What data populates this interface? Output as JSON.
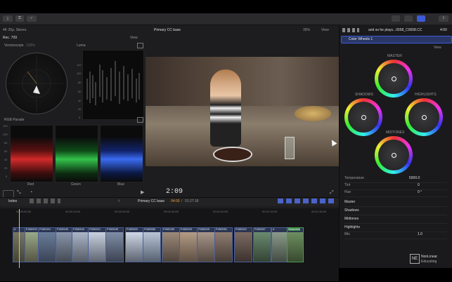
{
  "toolbar": {
    "left_icons": [
      "import-icon",
      "key-icon",
      "check-icon"
    ]
  },
  "browser": {
    "format": "4K 25p, Stereo",
    "color": "Rec. 709",
    "view": "View"
  },
  "scopes": {
    "vectorscope": "Vectorscope",
    "vectorscope_pct": "133%",
    "luma": "Luma",
    "rgb": "RGB Parade",
    "luma_ticks": [
      "120",
      "100",
      "80",
      "60",
      "40",
      "20",
      "0",
      "-20"
    ],
    "rgb_ticks": [
      "120",
      "100",
      "80",
      "60",
      "40",
      "20",
      "0",
      "-20"
    ],
    "rgb_labels": [
      "Red",
      "Green",
      "Blue"
    ]
  },
  "viewer": {
    "title": "Primary CC base",
    "zoom": "35%",
    "view": "View",
    "timecode": "2:09"
  },
  "inspector": {
    "clip_name": "and so he plays...0558_C0008.CC",
    "duration": "4:00",
    "effect": "Color Wheels 1",
    "view": "View",
    "wheels": [
      "MASTER",
      "SHADOWS",
      "HIGHLIGHTS",
      "MIDTONES"
    ],
    "params": [
      {
        "label": "Temperature",
        "value": "5000.0"
      },
      {
        "label": "Tint",
        "value": "0"
      },
      {
        "label": "Hue",
        "value": "0 °"
      }
    ],
    "sections": [
      "Master",
      "Shadows",
      "Midtones",
      "Highlights"
    ],
    "mix": {
      "label": "Mix",
      "value": "1.0"
    }
  },
  "timeline": {
    "index": "Index",
    "project": "Primary CC base",
    "position": "04:00",
    "duration": "01:27:18",
    "ruler": [
      "00:00:00:00",
      "00:00:15:00",
      "00:00:30:00",
      "00:00:45:00",
      "00:01:00:00",
      "00:01:15:00",
      "00:01:30:00"
    ],
    "clips": [
      "A",
      "P1582022",
      "P1582404",
      "P1582045",
      "P1582040",
      "P1582021",
      "P1583048",
      "P1583000",
      "P1583086",
      "P1583155",
      "P1583225",
      "P1583025",
      "P1583281",
      "P1583341",
      "P1583307",
      "Sharpness"
    ]
  },
  "watermark": {
    "brand": "NE",
    "line1": "NonLinear",
    "line2": "Educating"
  },
  "colors": {
    "accent": "#3d5bd6",
    "clip": "#2b3551",
    "app_bg": "#1d1d1f"
  }
}
